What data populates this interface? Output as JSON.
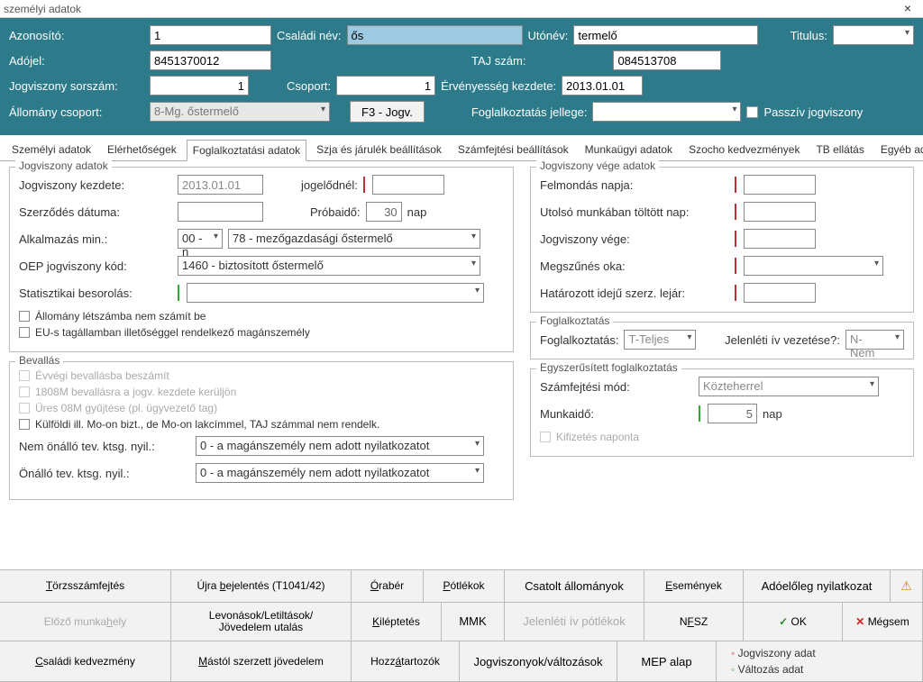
{
  "window": {
    "title": "személyi adatok",
    "close": "×"
  },
  "header": {
    "azonosito_label": "Azonosító:",
    "azonosito": "1",
    "csaladi_label": "Családi név:",
    "csaladi": "ős",
    "utonev_label": "Utónév:",
    "utonev": "termelő",
    "titulus_label": "Titulus:",
    "titulus": "",
    "adojel_label": "Adójel:",
    "adojel": "8451370012",
    "taj_label": "TAJ szám:",
    "taj": "084513708",
    "jogvsorszam_label": "Jogviszony sorszám:",
    "jogvsorszam": "1",
    "csoport_label": "Csoport:",
    "csoport": "1",
    "ervkezdete_label": "Érvényesség kezdete:",
    "ervkezdete": "2013.01.01",
    "allomany_label": "Állomány csoport:",
    "allomany": "8-Mg. őstermelő",
    "f3btn": "F3 - Jogv.",
    "fogljellege_label": "Foglalkoztatás jellege:",
    "fogljellege": "",
    "passziv": "Passzív jogviszony"
  },
  "tabs": {
    "items": [
      "Személyi adatok",
      "Elérhetőségek",
      "Foglalkoztatási adatok",
      "Szja és járulék beállítások",
      "Számfejtési beállítások",
      "Munkaügyi adatok",
      "Szocho kedvezmények",
      "TB ellátás",
      "Egyéb adatok"
    ]
  },
  "jogv": {
    "legend": "Jogviszony adatok",
    "kezdet_l": "Jogviszony kezdete:",
    "kezdet": "2013.01.01",
    "jogelodnel_l": "jogelődnél:",
    "jogelodnel": "",
    "szerzodes_l": "Szerződés dátuma:",
    "szerzodes": "",
    "probaido_l": "Próbaidő:",
    "probaido": "30",
    "nap": "nap",
    "alkmin_l": "Alkalmazás min.:",
    "alkmin_a": "00 - n",
    "alkmin_b": "78 - mezőgazdasági őstermelő",
    "oep_l": "OEP jogviszony kód:",
    "oep": "1460 - biztosított őstermelő",
    "stat_l": "Statisztikai besorolás:",
    "stat": "",
    "chk1": "Állomány létszámba nem számít be",
    "chk2": "EU-s tagállamban illetőséggel rendelkező magánszemély"
  },
  "bevallas": {
    "legend": "Bevallás",
    "c1": "Évvégi bevallásba beszámít",
    "c2": "1808M bevallásra a jogv. kezdete kerüljön",
    "c3": "Üres 08M gyűjtése (pl. ügyvezető tag)",
    "c4": "Külföldi ill. Mo-on bizt., de Mo-on lakcímmel, TAJ számmal nem rendelk.",
    "nemon_l": "Nem önálló tev. ktsg. nyil.:",
    "nemon": "0 - a magánszemély nem adott nyilatkozatot",
    "on_l": "Önálló tev. ktsg. nyil.:",
    "on": "0 - a magánszemély nem adott nyilatkozatot"
  },
  "vege": {
    "legend": "Jogviszony vége adatok",
    "felm_l": "Felmondás napja:",
    "utolso_l": "Utolsó munkában töltött nap:",
    "jogvege_l": "Jogviszony vége:",
    "megsz_l": "Megszűnés oka:",
    "hatar_l": "Határozott idejű szerz. lejár:"
  },
  "fogl": {
    "legend": "Foglalkoztatás",
    "fogl_l": "Foglalkoztatás:",
    "fogl": "T-Teljes",
    "jelenleti_l": "Jelenléti ív vezetése?:",
    "jelenleti": "N-Nem"
  },
  "egysz": {
    "legend": "Egyszerűsített foglalkoztatás",
    "szamf_l": "Számfejtési mód:",
    "szamf": "Közteherrel",
    "munkaido_l": "Munkaidő:",
    "munkaido": "5",
    "nap": "nap",
    "kifiz": "Kifizetés naponta"
  },
  "bottom": {
    "r1": {
      "torzs": "Törzsszámfejtés",
      "ujra": "Újra bejelentés (T1041/42)",
      "oraber": "Órabér",
      "potlekok": "Pótlékok",
      "csatolt": "Csatolt állományok",
      "esemenyek": "Események",
      "adoeloleg": "Adóelőleg nyilatkozat"
    },
    "r2": {
      "elozo": "Előző munkahely",
      "levonasok": "Levonások/Letiltások/ Jövedelem utalás",
      "kileptetes": "Kiléptetés",
      "mmk": "MMK",
      "jelenpot": "Jelenléti ív pótlékok",
      "nfsz": "NFSZ",
      "ok": "OK",
      "megsem": "Mégsem"
    },
    "r3": {
      "csaladi": "Családi kedvezmény",
      "mastol": "Mástól szerzett jövedelem",
      "hozz": "Hozzátartozók",
      "jogvalt": "Jogviszonyok/változások",
      "mepalap": "MEP alap",
      "leg1": "Jogviszony adat",
      "leg2": "Változás adat"
    }
  }
}
